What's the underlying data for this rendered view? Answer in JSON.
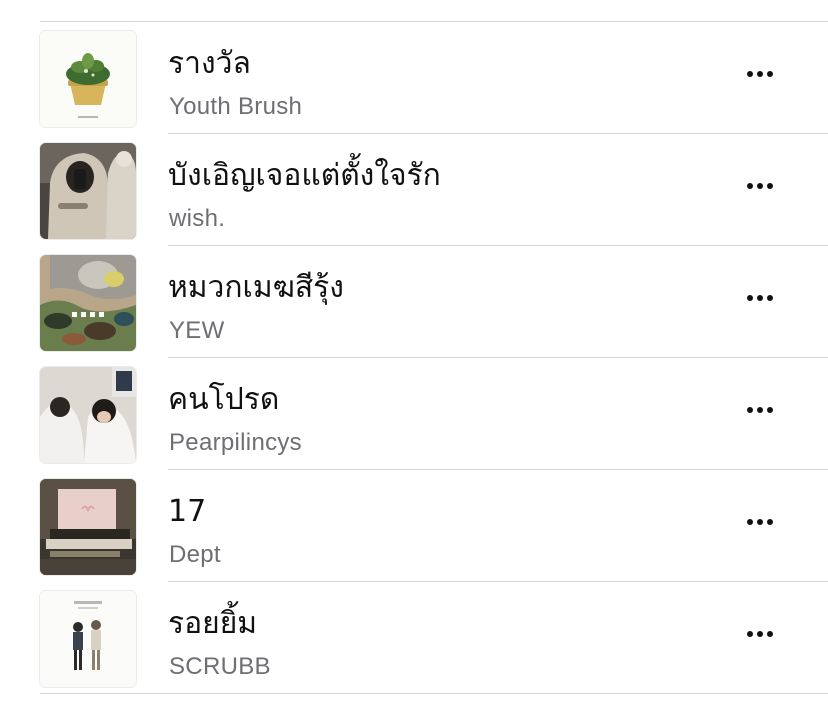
{
  "songs": [
    {
      "title": "รางวัล",
      "artist": "Youth Brush",
      "artwork": "album-art-plant-pot"
    },
    {
      "title": "บังเอิญเจอแต่ตั้งใจรัก",
      "artist": "wish.",
      "artwork": "album-art-hoodie-selfie"
    },
    {
      "title": "หมวกเมฆสีรุ้ง",
      "artist": "YEW",
      "artwork": "album-art-camo-illustration"
    },
    {
      "title": "คนโปรด",
      "artist": "Pearpilincys",
      "artwork": "album-art-blanket-couple"
    },
    {
      "title": "17",
      "artist": "Dept",
      "artwork": "album-art-laptop-desk"
    },
    {
      "title": "รอยยิ้ม",
      "artist": "SCRUBB",
      "artwork": "album-art-two-figures"
    }
  ],
  "colors": {
    "title": "#111111",
    "artist": "#6e6e73",
    "divider": "#d4d4d8",
    "background": "#ffffff"
  },
  "icons": {
    "more": "ellipsis-icon"
  }
}
